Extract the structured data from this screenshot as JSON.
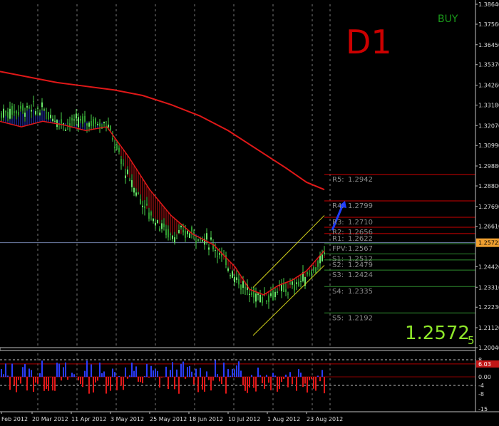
{
  "chart_data": {
    "type": "candlestick",
    "timeframe_label": "D1",
    "signal_label": "BUY",
    "current_price_display": "1.2572",
    "current_price_small_digit": "5",
    "current_price_tag": "1.25725",
    "price_axis_ticks": [
      "1.38640",
      "1.37560",
      "1.36450",
      "1.35370",
      "1.34260",
      "1.33180",
      "1.32070",
      "1.30990",
      "1.29880",
      "1.28800",
      "1.27690",
      "1.26610",
      "1.25725",
      "1.24420",
      "1.23310",
      "1.22230",
      "1.21120",
      "1.20040"
    ],
    "price_axis_values": [
      1.3864,
      1.3756,
      1.3645,
      1.3537,
      1.3426,
      1.3318,
      1.3207,
      1.3099,
      1.2988,
      1.288,
      1.2769,
      1.2661,
      1.25725,
      1.2442,
      1.2331,
      1.2223,
      1.2112,
      1.2004
    ],
    "ylim": [
      1.2004,
      1.3864
    ],
    "x_axis_labels": [
      "Feb 2012",
      "20 Mar 2012",
      "11 Apr 2012",
      "3 May 2012",
      "25 May 2012",
      "18 Jun 2012",
      "10 Jul 2012",
      "1 Aug 2012",
      "23 Aug 2012"
    ],
    "pivot_levels": [
      {
        "label": "R5:",
        "value": "1.2942",
        "color": "#cc0000"
      },
      {
        "label": "R4:",
        "value": "1.2799",
        "color": "#cc0000"
      },
      {
        "label": "R3:",
        "value": "1.2710",
        "color": "#cc0000"
      },
      {
        "label": "R2:",
        "value": "1.2656",
        "color": "#cc0000"
      },
      {
        "label": "R1:",
        "value": "1.2622",
        "color": "#cc0000"
      },
      {
        "label": "FPV:",
        "value": "1.2567",
        "color": "#2e8b2e"
      },
      {
        "label": "S1:",
        "value": "1.2512",
        "color": "#2e8b2e"
      },
      {
        "label": "S2:",
        "value": "1.2479",
        "color": "#2e8b2e"
      },
      {
        "label": "S3:",
        "value": "1.2424",
        "color": "#2e8b2e"
      },
      {
        "label": "S4:",
        "value": "1.2335",
        "color": "#2e8b2e"
      },
      {
        "label": "S5:",
        "value": "1.2192",
        "color": "#2e8b2e"
      }
    ],
    "slow_ma": [
      [
        0,
        1.35
      ],
      [
        40,
        1.347
      ],
      [
        80,
        1.344
      ],
      [
        120,
        1.342
      ],
      [
        160,
        1.34
      ],
      [
        200,
        1.337
      ],
      [
        240,
        1.332
      ],
      [
        280,
        1.326
      ],
      [
        320,
        1.318
      ],
      [
        360,
        1.308
      ],
      [
        400,
        1.298
      ],
      [
        430,
        1.29
      ],
      [
        455,
        1.286
      ]
    ],
    "fast_ma": [
      [
        0,
        1.323
      ],
      [
        30,
        1.32
      ],
      [
        60,
        1.323
      ],
      [
        90,
        1.321
      ],
      [
        120,
        1.318
      ],
      [
        150,
        1.32
      ],
      [
        180,
        1.304
      ],
      [
        210,
        1.286
      ],
      [
        240,
        1.272
      ],
      [
        270,
        1.262
      ],
      [
        300,
        1.256
      ],
      [
        330,
        1.244
      ],
      [
        350,
        1.232
      ],
      [
        370,
        1.229
      ],
      [
        390,
        1.234
      ],
      [
        410,
        1.237
      ],
      [
        430,
        1.242
      ],
      [
        455,
        1.253
      ]
    ],
    "ma_band_fill": [
      [
        0,
        1.327
      ],
      [
        30,
        1.33
      ],
      [
        60,
        1.329
      ],
      [
        90,
        1.322
      ],
      [
        120,
        1.323
      ],
      [
        150,
        1.322
      ],
      [
        180,
        1.292
      ],
      [
        210,
        1.273
      ],
      [
        240,
        1.261
      ],
      [
        270,
        1.263
      ],
      [
        300,
        1.256
      ],
      [
        330,
        1.239
      ],
      [
        350,
        1.23
      ],
      [
        370,
        1.228
      ],
      [
        390,
        1.231
      ],
      [
        410,
        1.233
      ],
      [
        430,
        1.239
      ],
      [
        455,
        1.249
      ]
    ],
    "channel": {
      "lower": [
        [
          355,
          1.207
        ],
        [
          455,
          1.245
        ]
      ],
      "upper": [
        [
          355,
          1.233
        ],
        [
          455,
          1.272
        ]
      ]
    },
    "osc_ticks": [
      "8",
      "6.03",
      "0.00",
      "-4",
      "-8",
      "-15"
    ],
    "osc_values": [
      8,
      6.03,
      0,
      -4,
      -8,
      -15
    ],
    "osc_ylim": [
      -15,
      11
    ]
  }
}
